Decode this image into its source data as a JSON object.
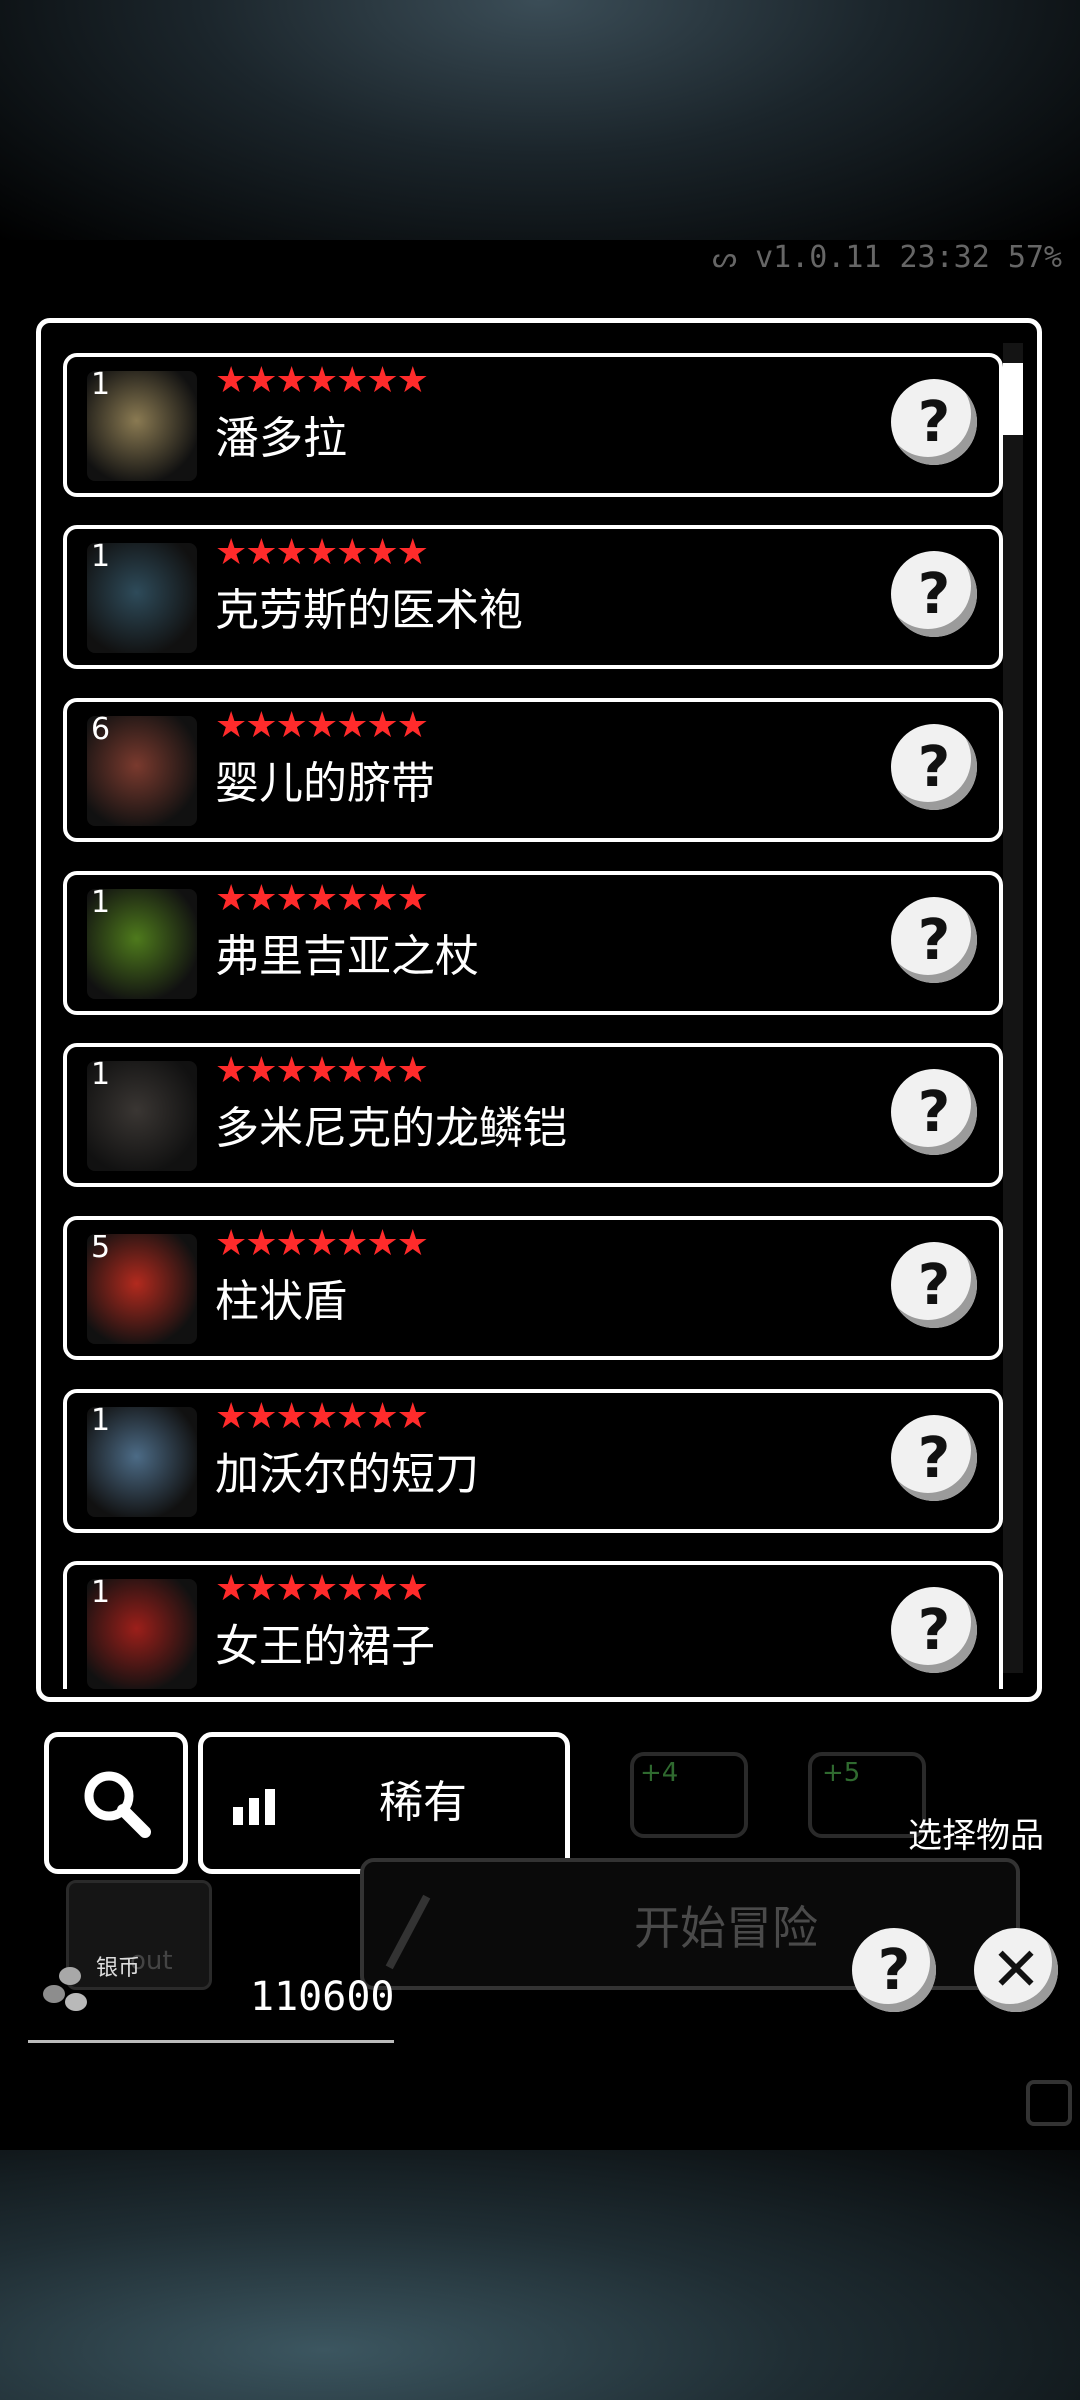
{
  "status_bar": {
    "version": "v1.0.11",
    "time": "23:32",
    "battery": "57%"
  },
  "items": [
    {
      "qty": "1",
      "stars": "★★★★★★★",
      "name": "潘多拉",
      "icon": "hammer-icon",
      "color": "#8a7a52"
    },
    {
      "qty": "1",
      "stars": "★★★★★★★",
      "name": "克劳斯的医术袍",
      "icon": "coat-icon",
      "color": "#2e4b5a"
    },
    {
      "qty": "6",
      "stars": "★★★★★★★",
      "name": "婴儿的脐带",
      "icon": "cord-icon",
      "color": "#7a3a2e"
    },
    {
      "qty": "1",
      "stars": "★★★★★★★",
      "name": "弗里吉亚之杖",
      "icon": "staff-icon",
      "color": "#4e7a1c"
    },
    {
      "qty": "1",
      "stars": "★★★★★★★",
      "name": "多米尼克的龙鳞铠",
      "icon": "armor-icon",
      "color": "#3a3633"
    },
    {
      "qty": "5",
      "stars": "★★★★★★★",
      "name": "柱状盾",
      "icon": "shield-icon",
      "color": "#b22a1e"
    },
    {
      "qty": "1",
      "stars": "★★★★★★★",
      "name": "加沃尔的短刀",
      "icon": "dagger-icon",
      "color": "#4c6b86"
    },
    {
      "qty": "1",
      "stars": "★★★★★★★",
      "name": "女王的裙子",
      "icon": "dress-icon",
      "color": "#9c1f1a"
    }
  ],
  "controls": {
    "rarity_label": "稀有",
    "select_items": "选择物品",
    "start_adventure": "开始冒险",
    "coin_label": "银币",
    "coin_label_ghost": "out",
    "coin_amount": "110600",
    "bonus_left": "+4",
    "bonus_right": "+5"
  },
  "glyphs": {
    "help": "?",
    "close": "✕"
  }
}
